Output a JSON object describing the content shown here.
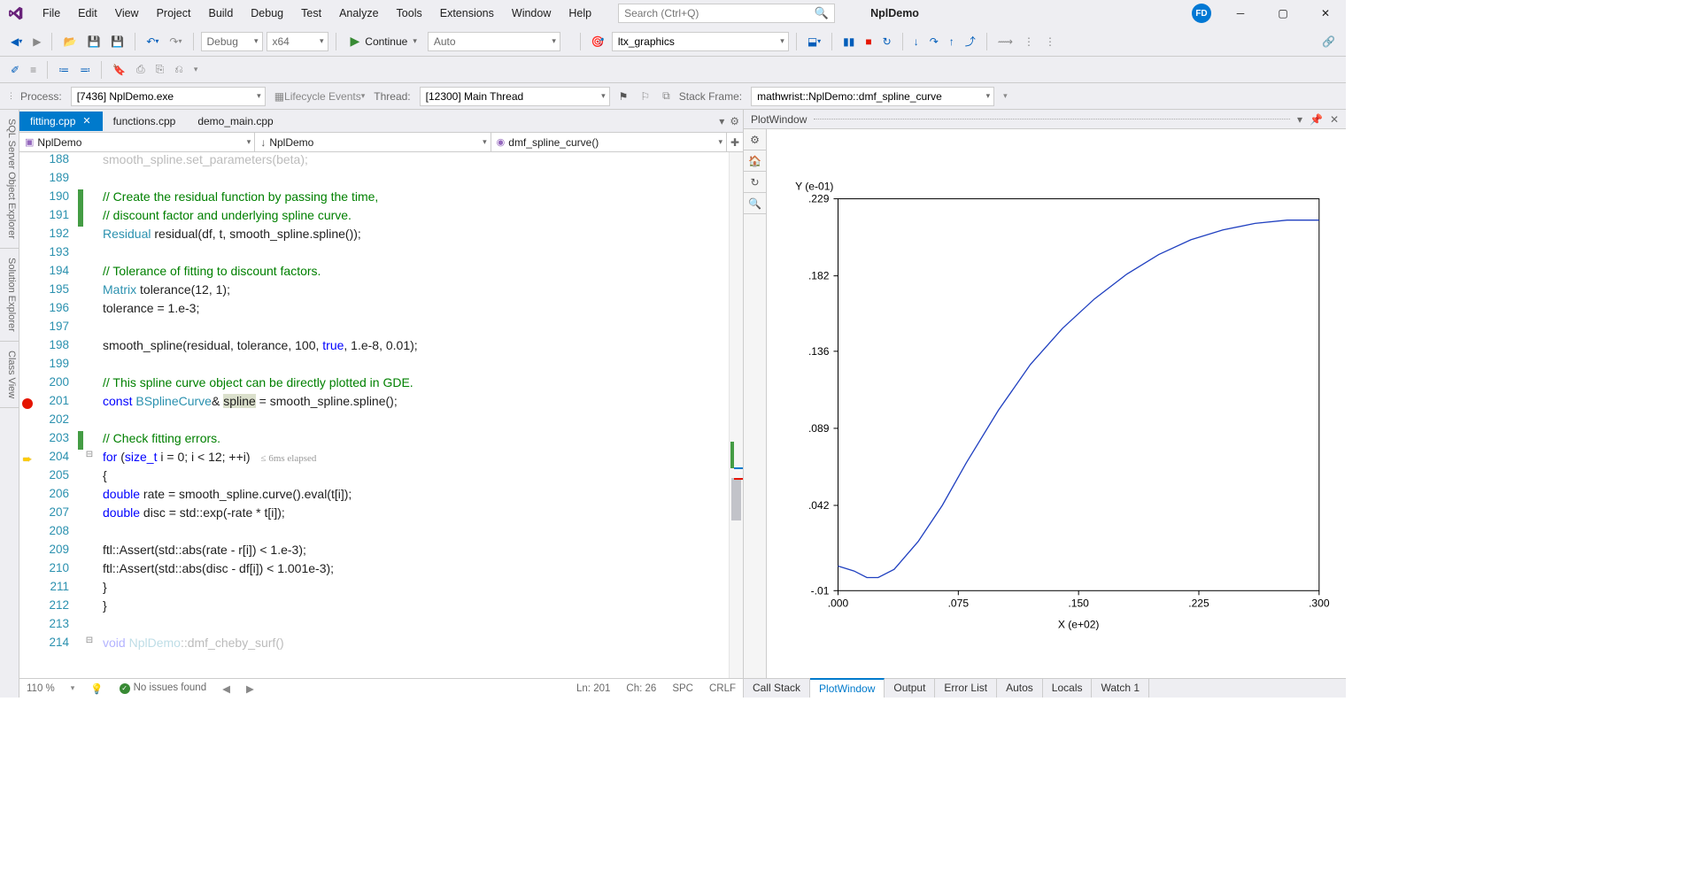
{
  "menu": [
    "File",
    "Edit",
    "View",
    "Project",
    "Build",
    "Debug",
    "Test",
    "Analyze",
    "Tools",
    "Extensions",
    "Window",
    "Help"
  ],
  "search_placeholder": "Search (Ctrl+Q)",
  "solution_name": "NplDemo",
  "user_initials": "FD",
  "toolbar1": {
    "config": "Debug",
    "platform": "x64",
    "continue_label": "Continue",
    "auto_label": "Auto",
    "target": "ltx_graphics"
  },
  "toolbar3": {
    "process_label": "Process:",
    "process_value": "[7436] NplDemo.exe",
    "lifecycle_label": "Lifecycle Events",
    "thread_label": "Thread:",
    "thread_value": "[12300] Main Thread",
    "stackframe_label": "Stack Frame:",
    "stackframe_value": "mathwrist::NplDemo::dmf_spline_curve"
  },
  "side_tabs": [
    "SQL Server Object Explorer",
    "Solution Explorer",
    "Class View"
  ],
  "file_tabs": [
    {
      "name": "fitting.cpp",
      "active": true
    },
    {
      "name": "functions.cpp",
      "active": false
    },
    {
      "name": "demo_main.cpp",
      "active": false
    }
  ],
  "nav": {
    "scope": "NplDemo",
    "class": "NplDemo",
    "method": "dmf_spline_curve()"
  },
  "code": {
    "start_line": 188,
    "lines": [
      {
        "n": 188,
        "text": "        smooth_spline.set_parameters(beta);",
        "fade": true
      },
      {
        "n": 189,
        "text": ""
      },
      {
        "n": 190,
        "text": "        // Create the residual function by passing the time,",
        "cm": true,
        "chg": true
      },
      {
        "n": 191,
        "text": "        // discount factor and underlying spline curve.",
        "cm": true,
        "chg": true
      },
      {
        "n": 192,
        "text": "        Residual residual(df, t, smooth_spline.spline());"
      },
      {
        "n": 193,
        "text": ""
      },
      {
        "n": 194,
        "text": "        // Tolerance of fitting to discount factors.",
        "cm": true
      },
      {
        "n": 195,
        "text": "        Matrix tolerance(12, 1);"
      },
      {
        "n": 196,
        "text": "        tolerance = 1.e-3;"
      },
      {
        "n": 197,
        "text": ""
      },
      {
        "n": 198,
        "text": "        smooth_spline(residual, tolerance, 100, true, 1.e-8, 0.01);",
        "chgR": true
      },
      {
        "n": 199,
        "text": ""
      },
      {
        "n": 200,
        "text": "        // This spline curve object can be directly plotted in GDE.",
        "cm": true,
        "chgR": true
      },
      {
        "n": 201,
        "text": "        const BSplineCurve& spline = smooth_spline.spline();",
        "bp": true,
        "chgR": true
      },
      {
        "n": 202,
        "text": ""
      },
      {
        "n": 203,
        "text": "        // Check fitting errors.",
        "cm": true,
        "chg": true
      },
      {
        "n": 204,
        "text": "        for (size_t i = 0; i < 12; ++i)",
        "arrow": true,
        "fold": "⊟",
        "elapsed": "≤ 6ms elapsed"
      },
      {
        "n": 205,
        "text": "        {",
        "chgR": true
      },
      {
        "n": 206,
        "text": "            double rate = smooth_spline.curve().eval(t[i]);",
        "chgR": true
      },
      {
        "n": 207,
        "text": "            double disc = std::exp(-rate * t[i]);"
      },
      {
        "n": 208,
        "text": ""
      },
      {
        "n": 209,
        "text": "            ftl::Assert(std::abs(rate - r[i]) < 1.e-3);"
      },
      {
        "n": 210,
        "text": "            ftl::Assert(std::abs(disc - df[i]) < 1.001e-3);"
      },
      {
        "n": 211,
        "text": "        }"
      },
      {
        "n": 212,
        "text": "    }"
      },
      {
        "n": 213,
        "text": ""
      },
      {
        "n": 214,
        "text": "    void NplDemo::dmf_cheby_surf()",
        "fade": true,
        "fold": "⊟"
      }
    ]
  },
  "editor_status": {
    "zoom": "110 %",
    "issues": "No issues found",
    "ln_label": "Ln:",
    "ln": "201",
    "ch_label": "Ch:",
    "ch": "26",
    "spc": "SPC",
    "crlf": "CRLF"
  },
  "plot_window_title": "PlotWindow",
  "bottom_tabs": [
    "Call Stack",
    "PlotWindow",
    "Output",
    "Error List",
    "Autos",
    "Locals",
    "Watch 1"
  ],
  "bottom_active": "PlotWindow",
  "chart_data": {
    "type": "line",
    "xlabel": "X (e+02)",
    "ylabel": "Y (e-01)",
    "xticks": [
      0.0,
      0.075,
      0.15,
      0.225,
      0.3
    ],
    "yticks": [
      -0.01,
      0.042,
      0.089,
      0.136,
      0.182,
      0.229
    ],
    "xlim": [
      0.0,
      0.3
    ],
    "ylim": [
      -0.01,
      0.229
    ],
    "series": [
      {
        "name": "curve",
        "color": "#2040c0",
        "x": [
          0.0,
          0.01,
          0.018,
          0.025,
          0.035,
          0.05,
          0.065,
          0.08,
          0.1,
          0.12,
          0.14,
          0.16,
          0.18,
          0.2,
          0.22,
          0.24,
          0.26,
          0.28,
          0.3
        ],
        "y": [
          0.005,
          0.002,
          -0.002,
          -0.002,
          0.003,
          0.02,
          0.042,
          0.068,
          0.1,
          0.128,
          0.15,
          0.168,
          0.183,
          0.195,
          0.204,
          0.21,
          0.214,
          0.216,
          0.216
        ]
      }
    ]
  }
}
